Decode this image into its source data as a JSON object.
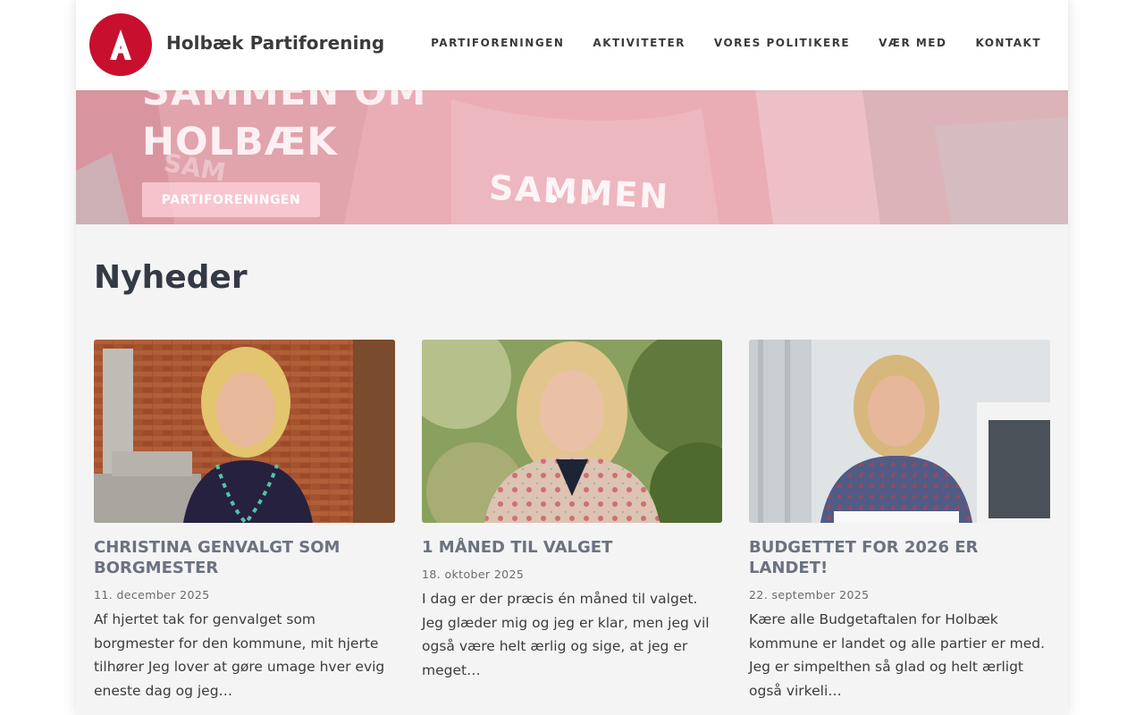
{
  "header": {
    "site_title": "Holbæk Partiforening",
    "nav": [
      {
        "label": "PARTIFORENINGEN"
      },
      {
        "label": "AKTIVITETER"
      },
      {
        "label": "VORES POLITIKERE"
      },
      {
        "label": "VÆR MED"
      },
      {
        "label": "KONTAKT"
      }
    ]
  },
  "hero": {
    "heading": "SAMMEN OM HOLBÆK",
    "button_label": "PARTIFORENINGEN",
    "jacket_text": "SAMMEN",
    "jacket_text_small": "SAM",
    "slide_count": 3,
    "active_slide": 1
  },
  "news": {
    "title": "Nyheder",
    "cards": [
      {
        "title": "CHRISTINA GENVALGT SOM BORGMESTER",
        "date": "11. december 2025",
        "excerpt": "Af hjertet tak for genvalget som borgmester for den kommune, mit hjerte tilhører Jeg lover at gøre umage hver evig eneste dag og jeg…"
      },
      {
        "title": "1 MÅNED TIL VALGET",
        "date": "18. oktober 2025",
        "excerpt": "I dag er der præcis én måned til valget. Jeg glæder mig og jeg er klar, men jeg vil også være helt ærlig og sige, at jeg er meget…"
      },
      {
        "title": "BUDGETTET FOR 2026 ER LANDET!",
        "date": "22. september 2025",
        "excerpt": "Kære alle Budgetaftalen for Holbæk kommune er landet og alle partier er med. Jeg er simpelthen så glad og helt ærligt også virkeli…"
      }
    ]
  },
  "colors": {
    "brand_red": "#c8102e",
    "heading_dark": "#333a44",
    "card_title_gray": "#6b7280"
  }
}
